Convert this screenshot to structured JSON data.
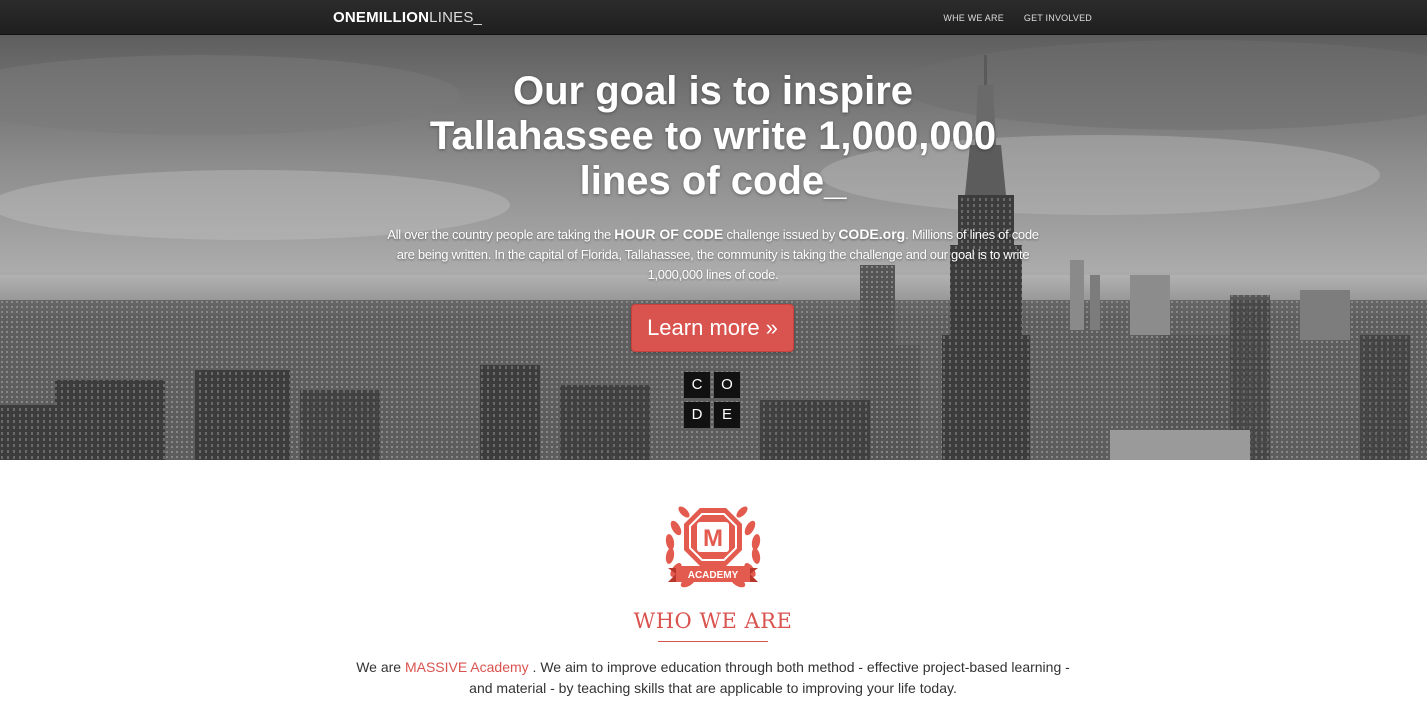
{
  "navbar": {
    "brand_bold": "ONEMILLION",
    "brand_light": "LINES_",
    "links": [
      {
        "label": "WHE WE ARE"
      },
      {
        "label": "GET INVOLVED"
      }
    ]
  },
  "hero": {
    "title_line1": "Our goal is to inspire",
    "title_line2": "Tallahassee to write 1,000,000",
    "title_line3": "lines of code_",
    "text_part1": "All over the country people are taking the ",
    "text_bold1": "HOUR OF CODE",
    "text_part2": " challenge issued by ",
    "text_bold2": "CODE.org",
    "text_part3": ". Millions of lines of code are being written. In the capital of Florida, Tallahassee, the community is taking the challenge and our goal is to write 1,000,000 lines of code.",
    "cta_label": "Learn more »",
    "code_letters": [
      "C",
      "O",
      "D",
      "E"
    ]
  },
  "about": {
    "badge_letter": "M",
    "badge_ribbon": "ACADEMY",
    "title": "WHO WE ARE",
    "text_part1": "We are ",
    "link_label": "MASSIVE Academy",
    "text_part2": " . We aim to improve education through both method - effective project-based learning - and material - by teaching skills that are applicable to improving your life today."
  },
  "colors": {
    "accent": "#d9534f",
    "navbar": "#222222",
    "code_tile": "#111111"
  }
}
